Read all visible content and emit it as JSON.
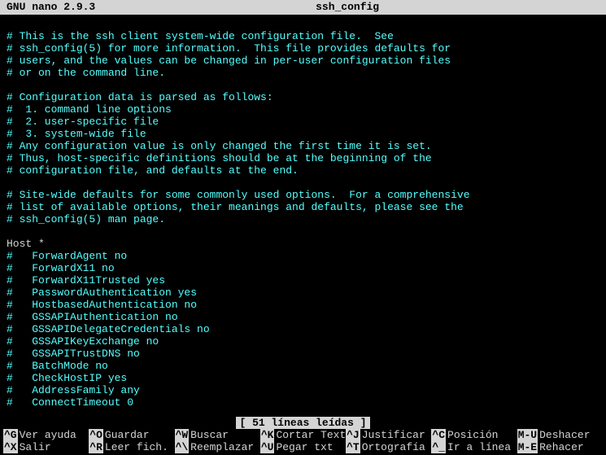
{
  "titlebar": {
    "app": "GNU nano 2.9.3",
    "filename": "ssh_config"
  },
  "content": {
    "lines": [
      {
        "text": "",
        "plain": false
      },
      {
        "text": "# This is the ssh client system-wide configuration file.  See",
        "plain": false
      },
      {
        "text": "# ssh_config(5) for more information.  This file provides defaults for",
        "plain": false
      },
      {
        "text": "# users, and the values can be changed in per-user configuration files",
        "plain": false
      },
      {
        "text": "# or on the command line.",
        "plain": false
      },
      {
        "text": "",
        "plain": false
      },
      {
        "text": "# Configuration data is parsed as follows:",
        "plain": false
      },
      {
        "text": "#  1. command line options",
        "plain": false
      },
      {
        "text": "#  2. user-specific file",
        "plain": false
      },
      {
        "text": "#  3. system-wide file",
        "plain": false
      },
      {
        "text": "# Any configuration value is only changed the first time it is set.",
        "plain": false
      },
      {
        "text": "# Thus, host-specific definitions should be at the beginning of the",
        "plain": false
      },
      {
        "text": "# configuration file, and defaults at the end.",
        "plain": false
      },
      {
        "text": "",
        "plain": false
      },
      {
        "text": "# Site-wide defaults for some commonly used options.  For a comprehensive",
        "plain": false
      },
      {
        "text": "# list of available options, their meanings and defaults, please see the",
        "plain": false
      },
      {
        "text": "# ssh_config(5) man page.",
        "plain": false
      },
      {
        "text": "",
        "plain": false
      },
      {
        "text": "Host *",
        "plain": true
      },
      {
        "text": "#   ForwardAgent no",
        "plain": false
      },
      {
        "text": "#   ForwardX11 no",
        "plain": false
      },
      {
        "text": "#   ForwardX11Trusted yes",
        "plain": false
      },
      {
        "text": "#   PasswordAuthentication yes",
        "plain": false
      },
      {
        "text": "#   HostbasedAuthentication no",
        "plain": false
      },
      {
        "text": "#   GSSAPIAuthentication no",
        "plain": false
      },
      {
        "text": "#   GSSAPIDelegateCredentials no",
        "plain": false
      },
      {
        "text": "#   GSSAPIKeyExchange no",
        "plain": false
      },
      {
        "text": "#   GSSAPITrustDNS no",
        "plain": false
      },
      {
        "text": "#   BatchMode no",
        "plain": false
      },
      {
        "text": "#   CheckHostIP yes",
        "plain": false
      },
      {
        "text": "#   AddressFamily any",
        "plain": false
      },
      {
        "text": "#   ConnectTimeout 0",
        "plain": false
      }
    ]
  },
  "statusbar": {
    "message": "[ 51 líneas leídas ]"
  },
  "shortcuts": {
    "row1": [
      {
        "key": "^G",
        "label": "Ver ayuda"
      },
      {
        "key": "^O",
        "label": "Guardar"
      },
      {
        "key": "^W",
        "label": "Buscar"
      },
      {
        "key": "^K",
        "label": "Cortar Text"
      },
      {
        "key": "^J",
        "label": "Justificar"
      },
      {
        "key": "^C",
        "label": "Posición"
      },
      {
        "key": "M-U",
        "label": "Deshacer"
      }
    ],
    "row2": [
      {
        "key": "^X",
        "label": "Salir"
      },
      {
        "key": "^R",
        "label": "Leer fich."
      },
      {
        "key": "^\\",
        "label": "Reemplazar"
      },
      {
        "key": "^U",
        "label": "Pegar txt"
      },
      {
        "key": "^T",
        "label": "Ortografía"
      },
      {
        "key": "^_",
        "label": "Ir a línea"
      },
      {
        "key": "M-E",
        "label": "Rehacer"
      }
    ]
  }
}
